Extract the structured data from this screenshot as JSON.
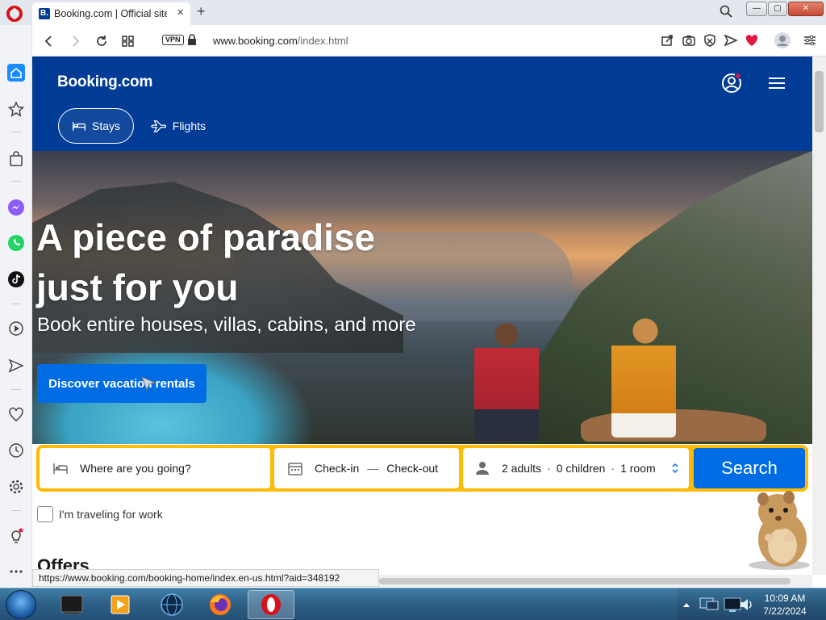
{
  "browser": {
    "tab_title": "Booking.com | Official site",
    "favicon_letter": "B.",
    "tab_close": "×",
    "new_tab": "+",
    "vpn_label": "VPN",
    "url_host": "www.booking.com",
    "url_path": "/index.html",
    "status_url": "https://www.booking.com/booking-home/index.en-us.html?aid=348192",
    "window": {
      "minimize": "—",
      "maximize": "▢",
      "close": "✕"
    }
  },
  "header": {
    "logo": "Booking.com",
    "nav": [
      {
        "label": "Stays",
        "active": true
      },
      {
        "label": "Flights",
        "active": false
      }
    ]
  },
  "hero": {
    "headline_line1": "A piece of paradise",
    "headline_line2": "just for you",
    "subtitle": "Book entire houses, villas, cabins, and more",
    "cta": "Discover vacation rentals"
  },
  "search": {
    "destination_placeholder": "Where are you going?",
    "checkin": "Check-in",
    "date_separator": "—",
    "checkout": "Check-out",
    "adults": "2 adults",
    "children": "0 children",
    "rooms": "1 room",
    "separator": "·",
    "button": "Search"
  },
  "work_travel": {
    "label": "I'm traveling for work",
    "checked": false
  },
  "offers_heading": "Offers",
  "taskbar": {
    "time": "10:09 AM",
    "date": "7/22/2024"
  },
  "colors": {
    "brand_blue": "#003b95",
    "action_blue": "#006ce4",
    "search_yellow": "#febb02",
    "opera_red": "#d7121a"
  }
}
